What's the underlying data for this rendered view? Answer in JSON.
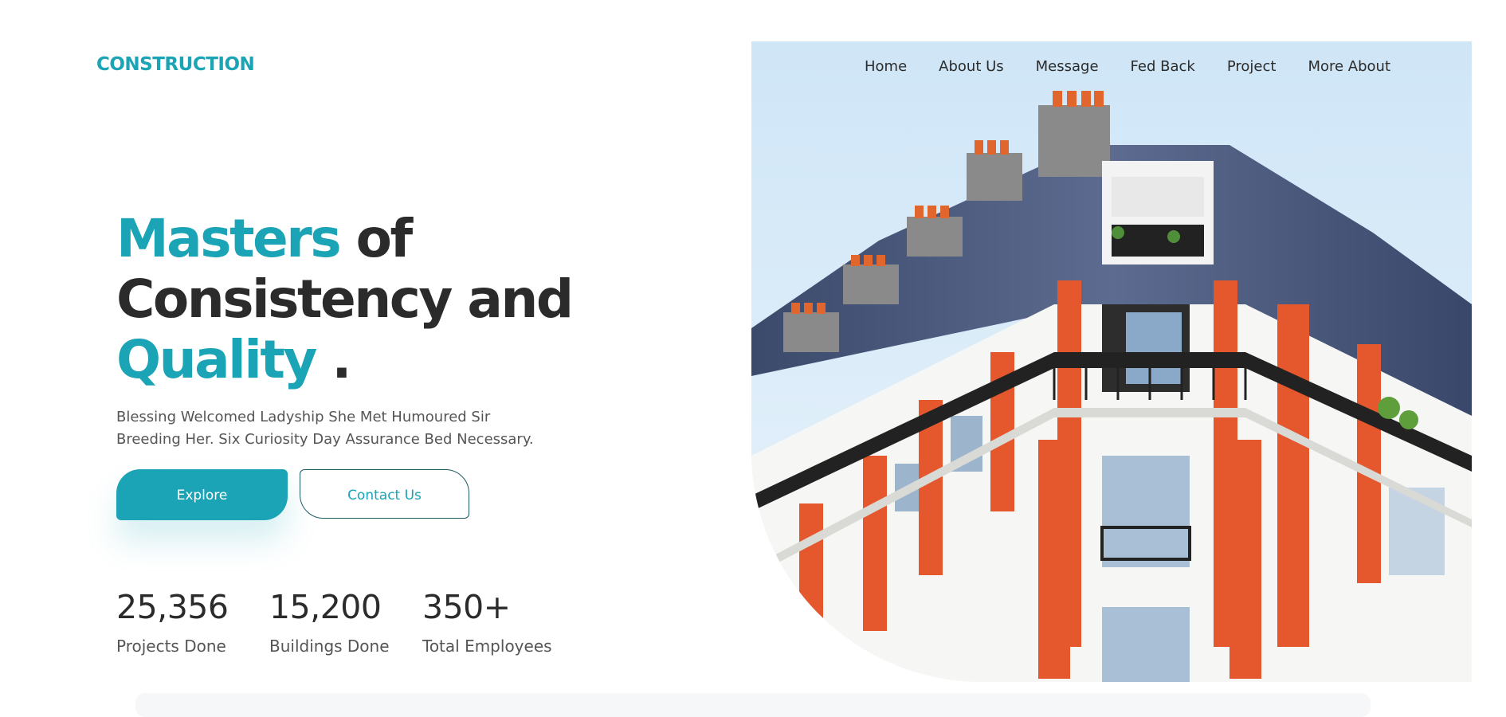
{
  "brand": {
    "logo": "CONSTRUCTION",
    "accent_color": "#1aa4b5"
  },
  "nav": {
    "items": [
      {
        "label": "Home"
      },
      {
        "label": "About Us"
      },
      {
        "label": "Message"
      },
      {
        "label": "Fed Back"
      },
      {
        "label": "Project"
      },
      {
        "label": "More About"
      }
    ]
  },
  "hero": {
    "headline": {
      "word1": "Masters",
      "word2": " of",
      "line2": "Consistency and",
      "word3": "Quality",
      "punct": " ."
    },
    "subtext": {
      "line1": "Blessing Welcomed Ladyship She Met Humoured Sir",
      "line2": "Breeding Her. Six Curiosity Day Assurance Bed Necessary."
    },
    "buttons": {
      "explore": "Explore",
      "contact": "Contact Us"
    },
    "image_icon": "building-photo"
  },
  "stats": [
    {
      "value": "25,356",
      "label": "Projects Done"
    },
    {
      "value": "15,200",
      "label": "Buildings Done"
    },
    {
      "value": "350+",
      "label": "Total Employees"
    }
  ]
}
